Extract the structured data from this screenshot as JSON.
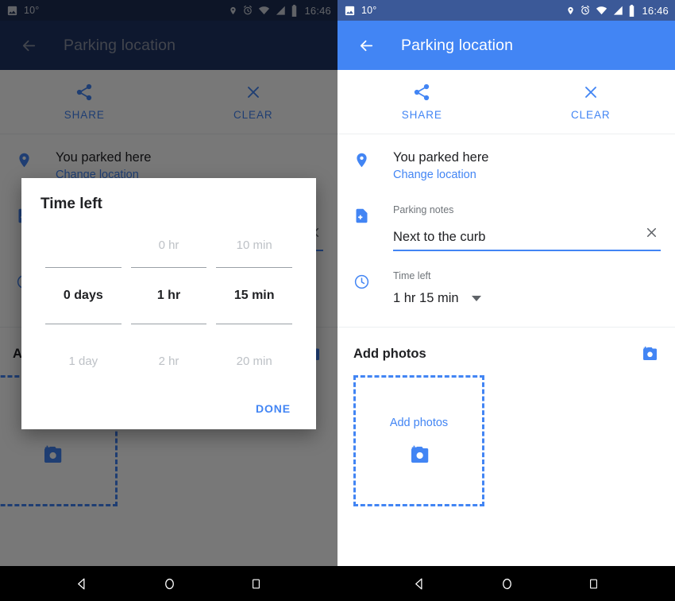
{
  "status_bar": {
    "temperature": "10°",
    "time": "16:46",
    "icons": [
      "image-icon",
      "location-pin-icon",
      "alarm-icon",
      "wifi-icon",
      "signal-icon",
      "battery-icon"
    ]
  },
  "app_bar": {
    "title": "Parking location",
    "back_icon": "back-arrow-icon"
  },
  "actions": [
    {
      "label": "SHARE",
      "icon": "share-icon"
    },
    {
      "label": "CLEAR",
      "icon": "close-icon"
    }
  ],
  "parked_row": {
    "icon": "location-pin-icon",
    "title": "You parked here",
    "link": "Change location"
  },
  "notes_row": {
    "icon": "note-add-icon",
    "label": "Parking notes",
    "value": "Next to the curb",
    "placeholder": "Parking notes",
    "clear_icon": "close-icon"
  },
  "time_row": {
    "icon": "clock-icon",
    "label": "Time left",
    "value": "1 hr 15 min",
    "caret_icon": "chevron-down-icon"
  },
  "photos": {
    "title": "Add photos",
    "add_icon": "add-a-photo-icon",
    "dropzone_label": "Add photos",
    "dropzone_icon": "add-a-photo-icon"
  },
  "dialog": {
    "title": "Time left",
    "columns": [
      {
        "above": "",
        "selected": "0 days",
        "below": "1 day"
      },
      {
        "above": "0 hr",
        "selected": "1 hr",
        "below": "2 hr"
      },
      {
        "above": "10 min",
        "selected": "15 min",
        "below": "20 min"
      }
    ],
    "done_label": "DONE"
  },
  "nav_bar": {
    "back_icon": "nav-back-triangle-icon",
    "home_icon": "nav-home-circle-icon",
    "recents_icon": "nav-recents-square-icon"
  },
  "colors": {
    "accent_blue": "#4285f4",
    "status_bar_blue": "#3b5998",
    "dim_app_bar": "#1f3464",
    "text_primary": "#202124",
    "text_secondary": "#70757a",
    "ghost_text": "#bdc1c6"
  }
}
